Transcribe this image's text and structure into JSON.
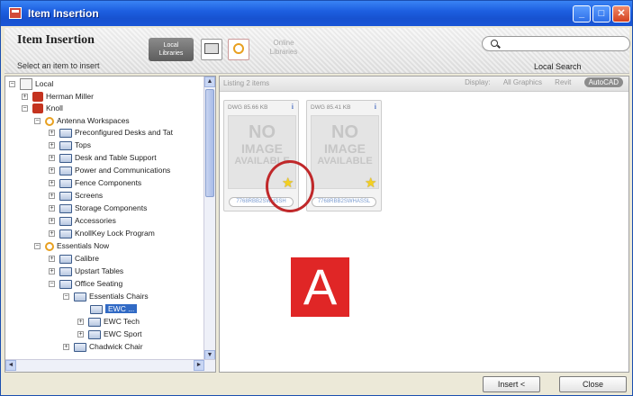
{
  "window": {
    "title": "Item Insertion"
  },
  "header": {
    "title": "Item Insertion",
    "subtitle": "Select an item to insert",
    "local_libraries": "Local\nLibraries",
    "online_libraries": "Online\nLibraries",
    "search_placeholder": "",
    "search_label": "Local Search"
  },
  "tree": {
    "items": [
      {
        "label": "Local"
      },
      {
        "label": "Herman Miller"
      },
      {
        "label": "Knoll"
      },
      {
        "label": "Antenna Workspaces"
      },
      {
        "label": "Preconfigured Desks and Tat"
      },
      {
        "label": "Tops"
      },
      {
        "label": "Desk and Table Support"
      },
      {
        "label": "Power and Communications"
      },
      {
        "label": "Fence Components"
      },
      {
        "label": "Screens"
      },
      {
        "label": "Storage Components"
      },
      {
        "label": "Accessories"
      },
      {
        "label": "KnollKey Lock Program"
      },
      {
        "label": "Essentials Now"
      },
      {
        "label": "Calibre"
      },
      {
        "label": "Upstart Tables"
      },
      {
        "label": "Office Seating"
      },
      {
        "label": "Essentials Chairs"
      },
      {
        "label": "EWC ..."
      },
      {
        "label": "EWC Tech"
      },
      {
        "label": "EWC Sport"
      },
      {
        "label": "Chadwick Chair"
      }
    ]
  },
  "list": {
    "count_text": "Listing 2 items",
    "display_label": "Display:",
    "display_options": [
      "All Graphics",
      "Revit",
      "AutoCAD"
    ],
    "active_option": "AutoCAD"
  },
  "cards": [
    {
      "type": "DWG",
      "size": "85.66 KB",
      "info": "i",
      "noimage": [
        "NO",
        "IMAGE",
        "AVAILABLE"
      ],
      "name": "7768RBB2SWHSSH"
    },
    {
      "type": "DWG",
      "size": "85.41 KB",
      "info": "i",
      "noimage": [
        "NO",
        "IMAGE",
        "AVAILABLE"
      ],
      "name": "7768RBB2SWHASSL"
    }
  ],
  "marker": {
    "label": "A"
  },
  "footer": {
    "insert_label": "Insert <",
    "close_label": "Close"
  },
  "colors": {
    "titlebar": "#1d5fe0",
    "selection": "#316ac5",
    "marker": "#e02626",
    "circle": "#c0282a",
    "star": "#f4d020"
  }
}
